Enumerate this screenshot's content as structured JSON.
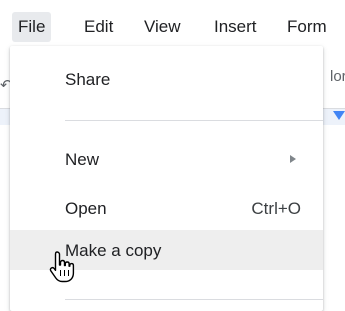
{
  "menubar": {
    "items": [
      {
        "label": "File"
      },
      {
        "label": "Edit"
      },
      {
        "label": "View"
      },
      {
        "label": "Insert"
      },
      {
        "label": "Form"
      }
    ],
    "active_index": 0
  },
  "background": {
    "toolbar_fragment": "lor",
    "left_glyph": "↶"
  },
  "file_menu": {
    "items": [
      {
        "label": "Share"
      },
      {
        "label": "New",
        "has_submenu": true
      },
      {
        "label": "Open",
        "shortcut": "Ctrl+O"
      },
      {
        "label": "Make a copy",
        "highlighted": true
      }
    ]
  },
  "cursor": {
    "icon": "hand-pointer-icon"
  },
  "colors": {
    "menu_highlight": "#eeeeee",
    "active_menubar_bg": "#e8eaed",
    "ruler_accent": "#4285f4",
    "text": "#202124"
  }
}
